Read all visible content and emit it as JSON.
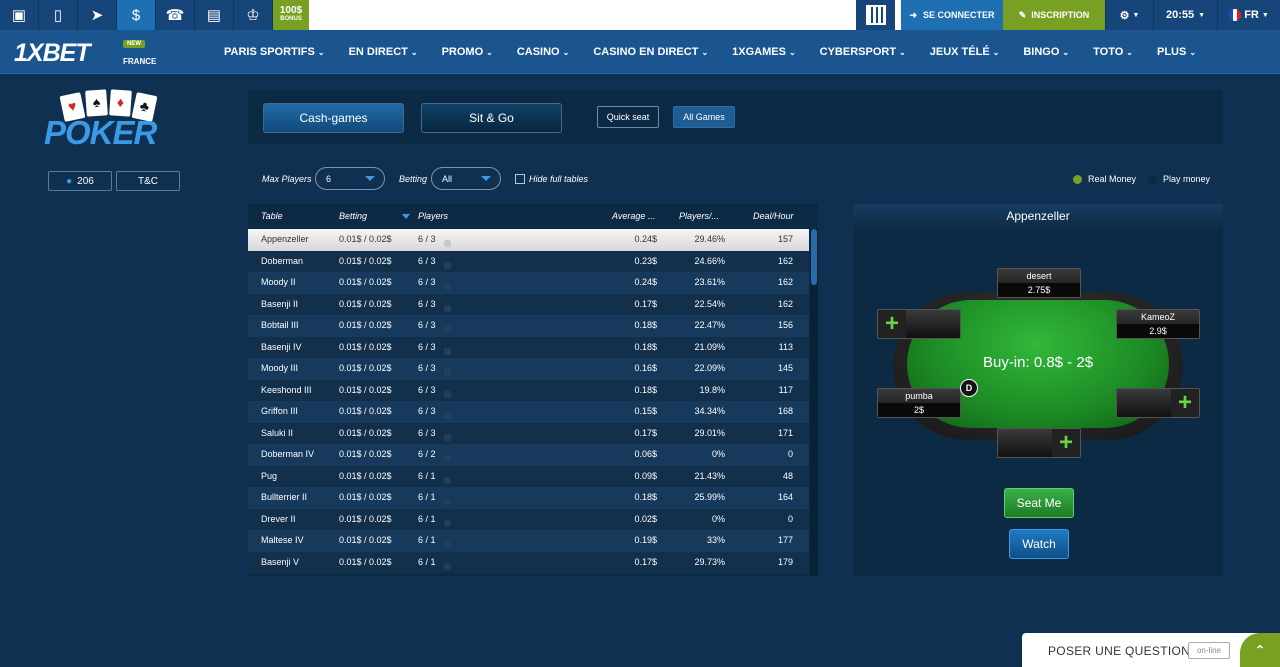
{
  "topbar": {
    "icons": [
      "desktop-icon",
      "mobile-icon",
      "telegram-icon",
      "dollar-icon",
      "phone-icon",
      "stats-icon",
      "trophy-icon"
    ],
    "bonus_big": "100$",
    "bonus_small": "BONUS",
    "login_label": "SE CONNECTER",
    "register_label": "INSCRIPTION",
    "time": "20:55",
    "lang": "FR"
  },
  "brand": {
    "logo": "1XBET",
    "new_badge": "NEW",
    "region": "FRANCE"
  },
  "nav": [
    "PARIS SPORTIFS",
    "EN DIRECT",
    "PROMO",
    "CASINO",
    "CASINO EN DIRECT",
    "1XGAMES",
    "CYBERSPORT",
    "JEUX TÉLÉ",
    "BINGO",
    "TOTO",
    "PLUS"
  ],
  "poker": {
    "logo_text": "POKER",
    "online_count": "206",
    "tc_label": "T&C"
  },
  "tabs": {
    "cash": "Cash-games",
    "sit": "Sit & Go",
    "quick_seat": "Quick seat",
    "all_games": "All Games"
  },
  "filters": {
    "max_players_label": "Max Players",
    "max_players_value": "6",
    "betting_label": "Betting",
    "betting_value": "All",
    "hide_full_label": "Hide full tables",
    "real_money_label": "Real Money",
    "play_money_label": "Play money",
    "real_money_color": "#78a023",
    "play_money_color": "#0d2a45"
  },
  "columns": {
    "table": "Table",
    "betting": "Betting",
    "players": "Players",
    "average": "Average ...",
    "players_pct": "Players/...",
    "deal_hour": "Deal/Hour"
  },
  "rows": [
    {
      "name": "Appenzeller",
      "bet": "0.01$ / 0.02$",
      "players": "6 / 3",
      "seated": 3,
      "avg": "0.24$",
      "pct": "29.46%",
      "deal": "157"
    },
    {
      "name": "Doberman",
      "bet": "0.01$ / 0.02$",
      "players": "6 / 3",
      "seated": 3,
      "avg": "0.23$",
      "pct": "24.66%",
      "deal": "162"
    },
    {
      "name": "Moody II",
      "bet": "0.01$ / 0.02$",
      "players": "6 / 3",
      "seated": 3,
      "avg": "0.24$",
      "pct": "23.61%",
      "deal": "162"
    },
    {
      "name": "Basenji II",
      "bet": "0.01$ / 0.02$",
      "players": "6 / 3",
      "seated": 3,
      "avg": "0.17$",
      "pct": "22.54%",
      "deal": "162"
    },
    {
      "name": "Bobtail III",
      "bet": "0.01$ / 0.02$",
      "players": "6 / 3",
      "seated": 3,
      "avg": "0.18$",
      "pct": "22.47%",
      "deal": "156"
    },
    {
      "name": "Basenji IV",
      "bet": "0.01$ / 0.02$",
      "players": "6 / 3",
      "seated": 3,
      "avg": "0.18$",
      "pct": "21.09%",
      "deal": "113"
    },
    {
      "name": "Moody III",
      "bet": "0.01$ / 0.02$",
      "players": "6 / 3",
      "seated": 3,
      "avg": "0.16$",
      "pct": "22.09%",
      "deal": "145"
    },
    {
      "name": "Keeshond III",
      "bet": "0.01$ / 0.02$",
      "players": "6 / 3",
      "seated": 3,
      "avg": "0.18$",
      "pct": "19.8%",
      "deal": "117"
    },
    {
      "name": "Griffon III",
      "bet": "0.01$ / 0.02$",
      "players": "6 / 3",
      "seated": 3,
      "avg": "0.15$",
      "pct": "34.34%",
      "deal": "168"
    },
    {
      "name": "Saluki II",
      "bet": "0.01$ / 0.02$",
      "players": "6 / 3",
      "seated": 3,
      "avg": "0.17$",
      "pct": "29.01%",
      "deal": "171"
    },
    {
      "name": "Doberman IV",
      "bet": "0.01$ / 0.02$",
      "players": "6 / 2",
      "seated": 2,
      "avg": "0.06$",
      "pct": "0%",
      "deal": "0"
    },
    {
      "name": "Pug",
      "bet": "0.01$ / 0.02$",
      "players": "6 / 1",
      "seated": 1,
      "avg": "0.09$",
      "pct": "21.43%",
      "deal": "48"
    },
    {
      "name": "Bullterrier II",
      "bet": "0.01$ / 0.02$",
      "players": "6 / 1",
      "seated": 1,
      "avg": "0.18$",
      "pct": "25.99%",
      "deal": "164"
    },
    {
      "name": "Drever II",
      "bet": "0.01$ / 0.02$",
      "players": "6 / 1",
      "seated": 1,
      "avg": "0.02$",
      "pct": "0%",
      "deal": "0"
    },
    {
      "name": "Maltese IV",
      "bet": "0.01$ / 0.02$",
      "players": "6 / 1",
      "seated": 1,
      "avg": "0.19$",
      "pct": "33%",
      "deal": "177"
    },
    {
      "name": "Basenji V",
      "bet": "0.01$ / 0.02$",
      "players": "6 / 1",
      "seated": 1,
      "avg": "0.17$",
      "pct": "29.73%",
      "deal": "179"
    }
  ],
  "preview": {
    "title": "Appenzeller",
    "buyin": "Buy-in: 0.8$ - 2$",
    "dealer": "D",
    "players": [
      {
        "name": "desert",
        "stack": "2.75$"
      },
      {
        "name": "KameoZ",
        "stack": "2.9$"
      },
      {
        "name": "pumba",
        "stack": "2$"
      }
    ],
    "seat_me": "Seat Me",
    "watch": "Watch"
  },
  "help": {
    "ask": "POSER UNE QUESTION",
    "status": "on-line"
  }
}
